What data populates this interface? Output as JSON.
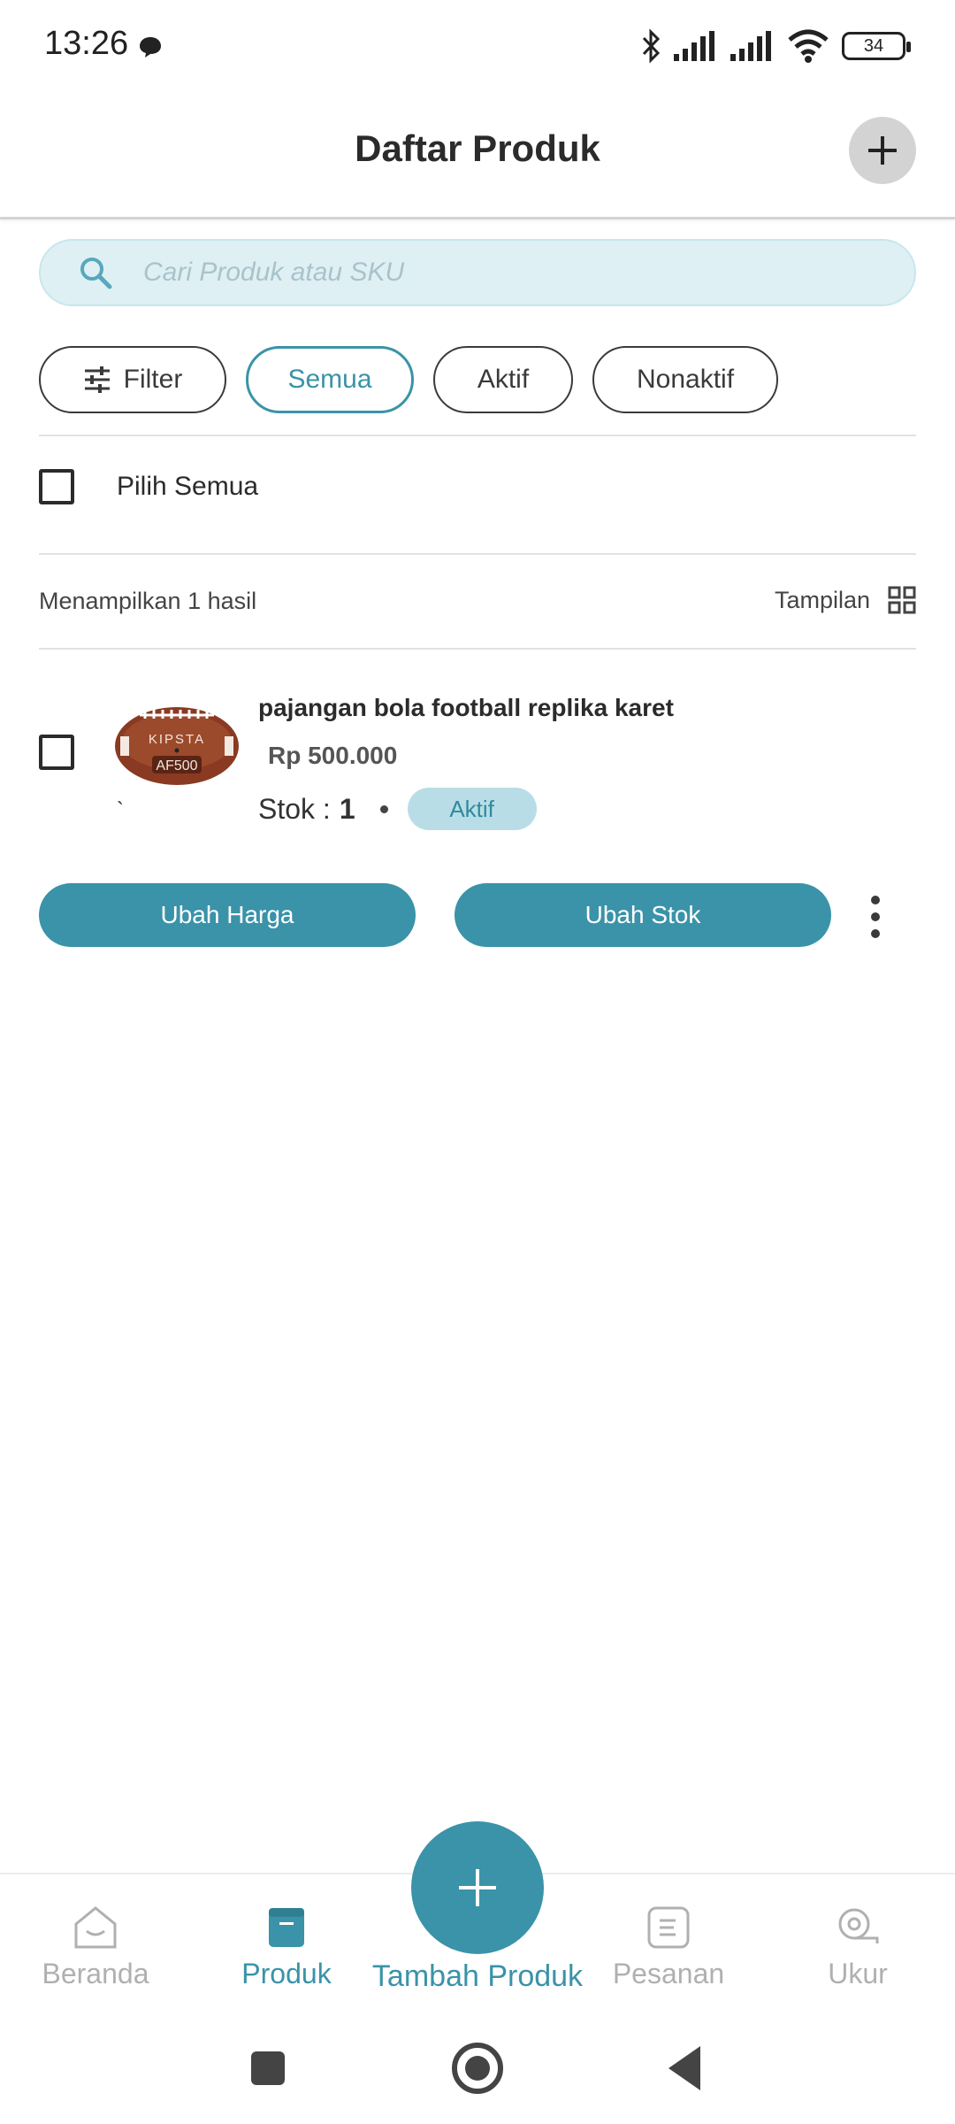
{
  "status_bar": {
    "time": "13:26",
    "battery": "34"
  },
  "header": {
    "title": "Daftar Produk",
    "add_icon": "plus-icon"
  },
  "search": {
    "placeholder": "Cari Produk atau SKU"
  },
  "filters": {
    "filter_label": "Filter",
    "chips": [
      "Semua",
      "Aktif",
      "Nonaktif"
    ],
    "selected": "Semua"
  },
  "select_all": {
    "label": "Pilih Semua",
    "checked": false
  },
  "results": {
    "count_text": "Menampilkan 1 hasil",
    "view_label": "Tampilan"
  },
  "products": [
    {
      "name": "pajangan bola football replika karet",
      "price": "Rp 500.000",
      "stock_label": "Stok :",
      "stock_value": "1",
      "status": "Aktif",
      "image_text": [
        "KIPSTA",
        "AF500"
      ],
      "tick_mark": "`",
      "actions": {
        "price_button": "Ubah Harga",
        "stock_button": "Ubah Stok"
      }
    }
  ],
  "bottom_nav": {
    "items": [
      {
        "label": "Beranda",
        "icon": "home-icon"
      },
      {
        "label": "Produk",
        "icon": "product-box-icon"
      },
      {
        "label": "Tambah Produk",
        "icon": "plus-icon"
      },
      {
        "label": "Pesanan",
        "icon": "order-list-icon"
      },
      {
        "label": "Ukur",
        "icon": "measure-tape-icon"
      }
    ],
    "active": "Produk"
  },
  "colors": {
    "accent": "#3a93a8",
    "search_bg": "#dff0f4",
    "badge_bg": "#b9dde6",
    "inactive_nav": "#b0b0b0"
  }
}
